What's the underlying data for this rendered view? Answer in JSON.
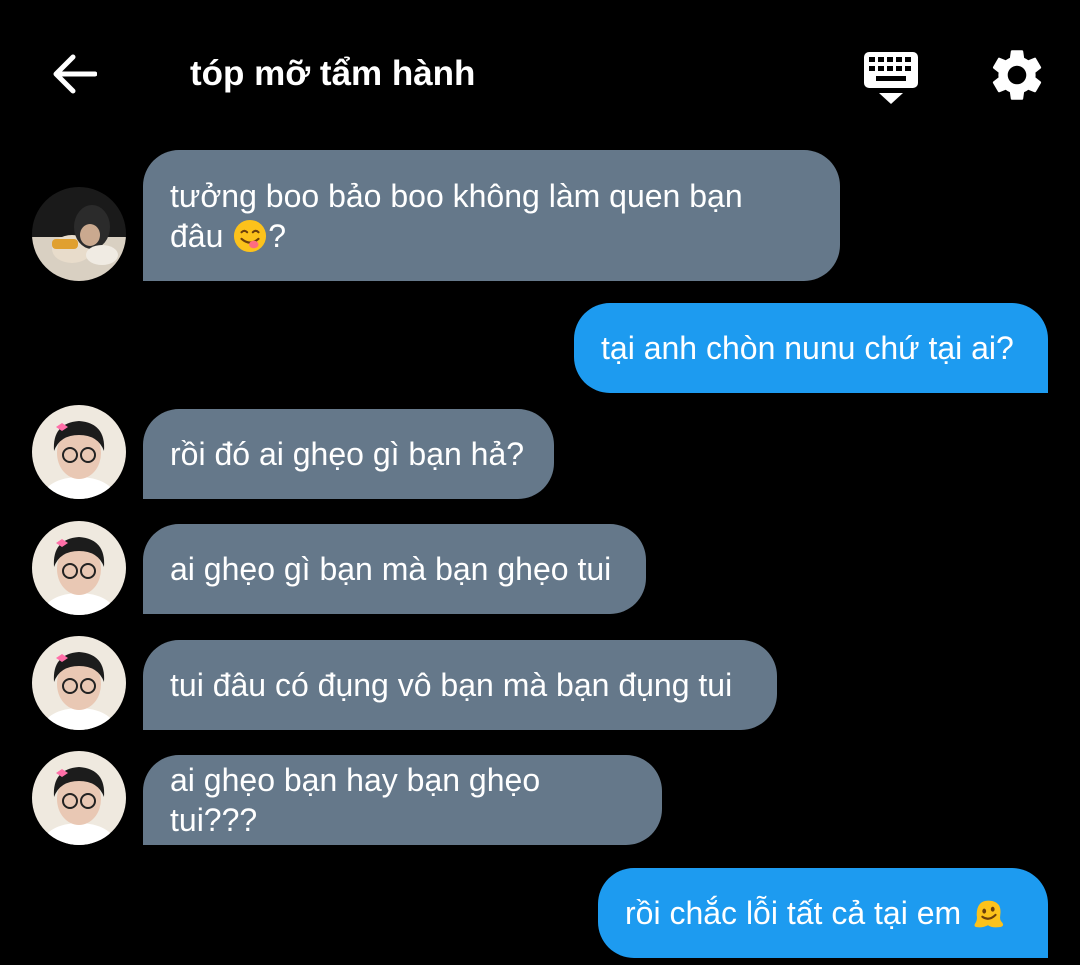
{
  "header": {
    "title": "tóp mỡ tẩm hành",
    "back_icon": "arrow-left-icon",
    "keyboard_icon": "keyboard-icon",
    "settings_icon": "gear-icon"
  },
  "colors": {
    "background": "#000000",
    "incoming_bubble": "#65788a",
    "outgoing_bubble": "#1d9bf0",
    "text": "#ffffff"
  },
  "messages": [
    {
      "direction": "incoming",
      "line1": "tưởng boo bảo boo không làm quen bạn",
      "line2": "đâu",
      "emoji": "face-savoring-food-emoji",
      "suffix": "?"
    },
    {
      "direction": "outgoing",
      "text": "tại anh chòn nunu chứ tại ai?"
    },
    {
      "direction": "incoming",
      "text": "rồi đó ai ghẹo gì bạn hả?"
    },
    {
      "direction": "incoming",
      "text": "ai ghẹo gì bạn mà bạn ghẹo tui"
    },
    {
      "direction": "incoming",
      "text": "tui đâu có đụng vô bạn mà bạn đụng tui"
    },
    {
      "direction": "incoming",
      "text": "ai ghẹo bạn hay bạn ghẹo tui???"
    },
    {
      "direction": "outgoing",
      "text": "rồi chắc lỗi tất cả tại em",
      "emoji": "melting-face-emoji"
    }
  ]
}
